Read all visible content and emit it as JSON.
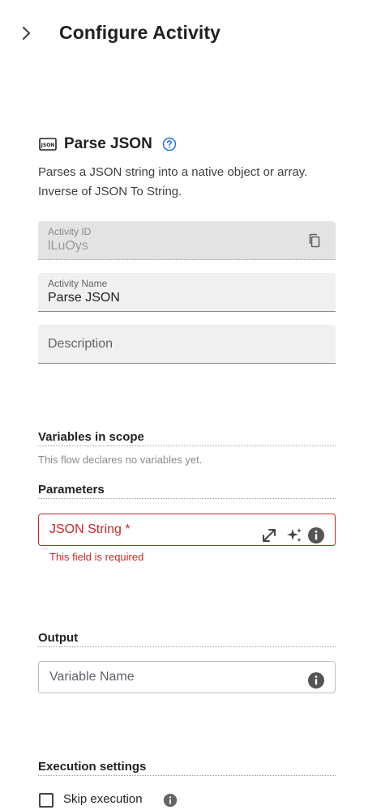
{
  "header": {
    "title": "Configure Activity",
    "back_icon": "chevron-right-icon"
  },
  "activity": {
    "icon": "json-icon",
    "title": "Parse JSON",
    "help_icon": "help-circle-icon",
    "description": "Parses a JSON string into a native object or array. Inverse of JSON To String."
  },
  "fields": {
    "activity_id": {
      "label": "Activity ID",
      "value": "lLuOys",
      "icon": "copy-icon"
    },
    "activity_name": {
      "label": "Activity Name",
      "value": "Parse JSON"
    },
    "description": {
      "placeholder": "Description"
    }
  },
  "variables": {
    "title": "Variables in scope",
    "empty_text": "This flow declares no variables yet."
  },
  "parameters": {
    "title": "Parameters",
    "json_string": {
      "label": "JSON String *",
      "error": "This field is required",
      "icons": [
        "expand-icon",
        "sparkles-icon",
        "info-icon"
      ]
    }
  },
  "output": {
    "title": "Output",
    "variable_name": {
      "placeholder": "Variable Name",
      "icon": "info-icon"
    }
  },
  "execution": {
    "title": "Execution settings",
    "skip_label": "Skip execution",
    "skip_checked": false,
    "icon": "info-icon"
  },
  "colors": {
    "error": "#c62828",
    "help_blue": "#1a73e8",
    "field_bg": "#f0f0f0",
    "disabled_bg": "#e3e3e3"
  }
}
